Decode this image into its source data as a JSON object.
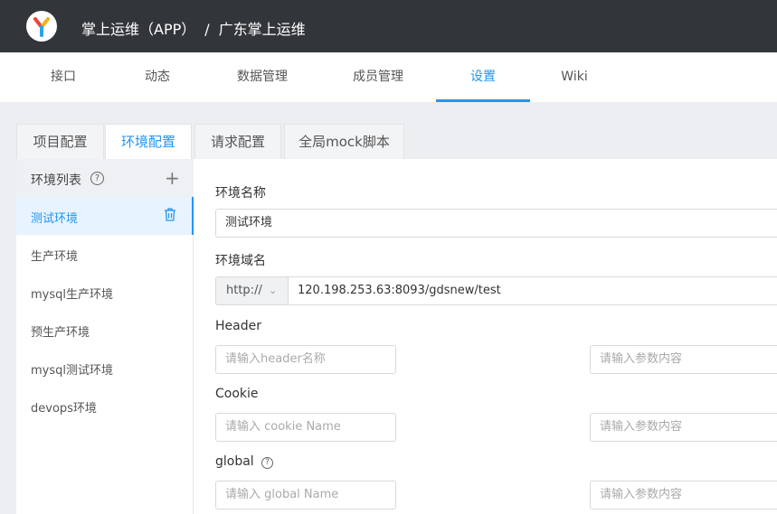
{
  "header": {
    "project_label": "掌上运维（APP）",
    "separator": "/",
    "group_label": "广东掌上运维"
  },
  "nav": {
    "items": [
      {
        "label": "接口"
      },
      {
        "label": "动态"
      },
      {
        "label": "数据管理"
      },
      {
        "label": "成员管理"
      },
      {
        "label": "设置"
      },
      {
        "label": "Wiki"
      }
    ],
    "active": "设置"
  },
  "tabs": [
    {
      "label": "项目配置"
    },
    {
      "label": "环境配置"
    },
    {
      "label": "请求配置"
    },
    {
      "label": "全局mock脚本"
    }
  ],
  "env_list": {
    "title": "环境列表",
    "help_glyph": "?",
    "add_glyph": "+",
    "items": [
      {
        "label": "测试环境"
      },
      {
        "label": "生产环境"
      },
      {
        "label": "mysql生产环境"
      },
      {
        "label": "预生产环境"
      },
      {
        "label": "mysql测试环境"
      },
      {
        "label": "devops环境"
      }
    ]
  },
  "form": {
    "env_name_label": "环境名称",
    "env_name_value": "测试环境",
    "domain_label": "环境域名",
    "protocol_value": "http://",
    "domain_value": "120.198.253.63:8093/gdsnew/test",
    "header_label": "Header",
    "header_name_placeholder": "请输入header名称",
    "header_value_placeholder": "请输入参数内容",
    "cookie_label": "Cookie",
    "cookie_name_placeholder": "请输入 cookie Name",
    "cookie_value_placeholder": "请输入参数内容",
    "global_label": "global",
    "global_help_glyph": "?",
    "global_name_placeholder": "请输入 global Name",
    "global_value_placeholder": "请输入参数内容"
  },
  "colors": {
    "topbar": "#32363a",
    "accent": "#2395f1",
    "active_row": "#e7f3fe"
  }
}
